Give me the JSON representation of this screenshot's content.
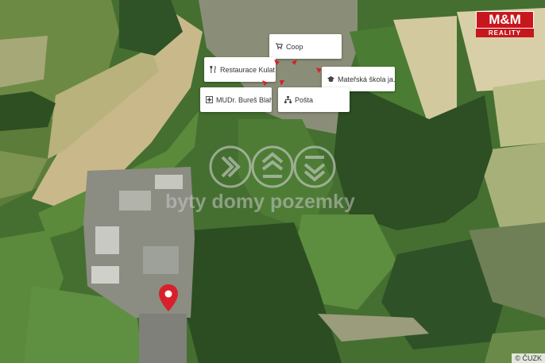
{
  "map": {
    "type": "aerial-satellite",
    "pois": [
      {
        "name": "Coop",
        "icon": "cart-icon"
      },
      {
        "name": "Restaurace Kulat…",
        "icon": "cutlery-icon"
      },
      {
        "name": "Mateřská škola ja…",
        "icon": "graduation-cap-icon"
      },
      {
        "name": "MUDr. Bureš Blah…",
        "icon": "medical-cross-icon"
      },
      {
        "name": "Pošta",
        "icon": "sitemap-icon"
      }
    ],
    "watermark_text": "byty domy pozemky",
    "copyright": "© ČUZK",
    "pin_color": "#d8202a"
  },
  "brand": {
    "logo_top": "M&M",
    "logo_bottom": "REALITY",
    "color": "#c8161d"
  }
}
